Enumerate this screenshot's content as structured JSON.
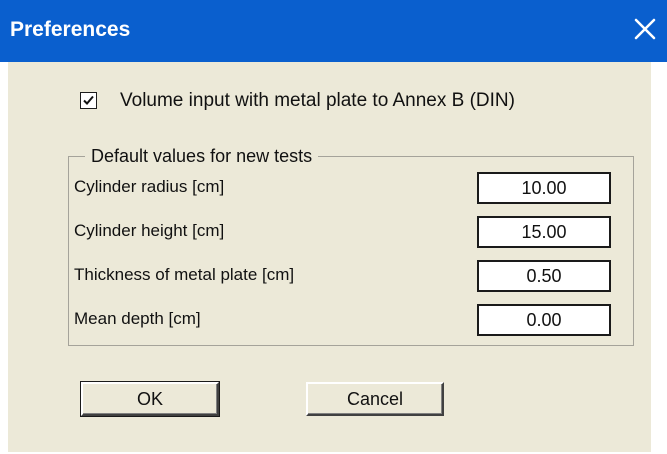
{
  "window": {
    "title": "Preferences",
    "close_icon": "close-icon",
    "colors": {
      "titlebar": "#0a5fce",
      "body": "#ece9d8"
    }
  },
  "volume_option": {
    "label": "Volume input with metal plate to Annex B (DIN)",
    "checked": true
  },
  "defaults_group": {
    "legend": "Default values for new tests",
    "fields": [
      {
        "label": "Cylinder radius [cm]",
        "value": "10.00"
      },
      {
        "label": "Cylinder height [cm]",
        "value": "15.00"
      },
      {
        "label": "Thickness of metal plate [cm]",
        "value": "0.50"
      },
      {
        "label": "Mean depth [cm]",
        "value": "0.00"
      }
    ]
  },
  "buttons": {
    "ok_label": "OK",
    "cancel_label": "Cancel"
  }
}
